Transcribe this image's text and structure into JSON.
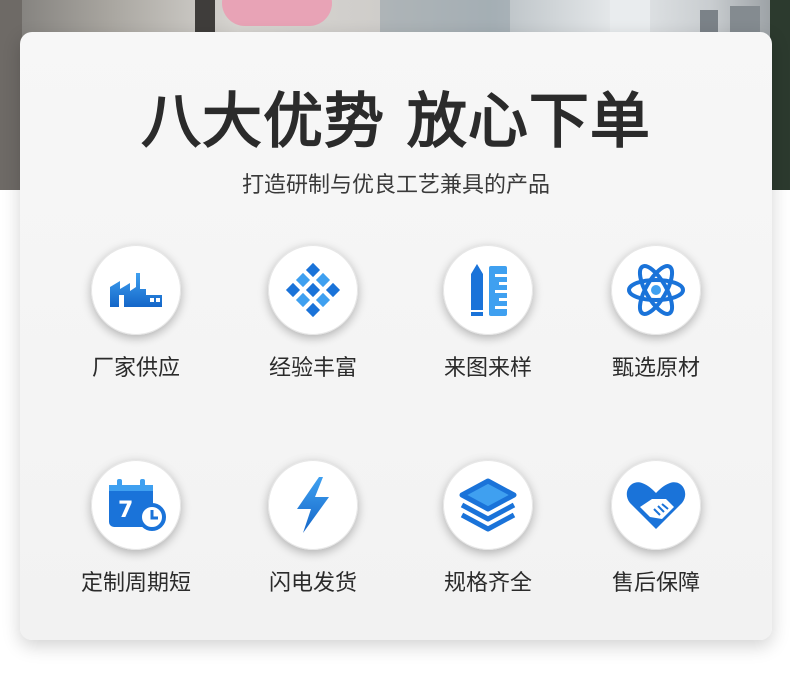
{
  "header": {
    "title": "八大优势 放心下单",
    "subtitle": "打造研制与优良工艺兼具的产品"
  },
  "colors": {
    "icon_blue": "#1a73d9",
    "icon_blue_light": "#3fa0f0",
    "text": "#2b2b2b",
    "card": "#f4f4f4"
  },
  "features": [
    {
      "icon": "factory-icon",
      "label": "厂家供应"
    },
    {
      "icon": "diamond-grid-icon",
      "label": "经验丰富"
    },
    {
      "icon": "ruler-pencil-icon",
      "label": "来图来样"
    },
    {
      "icon": "atom-icon",
      "label": "甄选原材"
    },
    {
      "icon": "calendar-clock-icon",
      "label": "定制周期短"
    },
    {
      "icon": "lightning-icon",
      "label": "闪电发货"
    },
    {
      "icon": "layers-icon",
      "label": "规格齐全"
    },
    {
      "icon": "handshake-heart-icon",
      "label": "售后保障"
    }
  ],
  "calendar_day": "7"
}
